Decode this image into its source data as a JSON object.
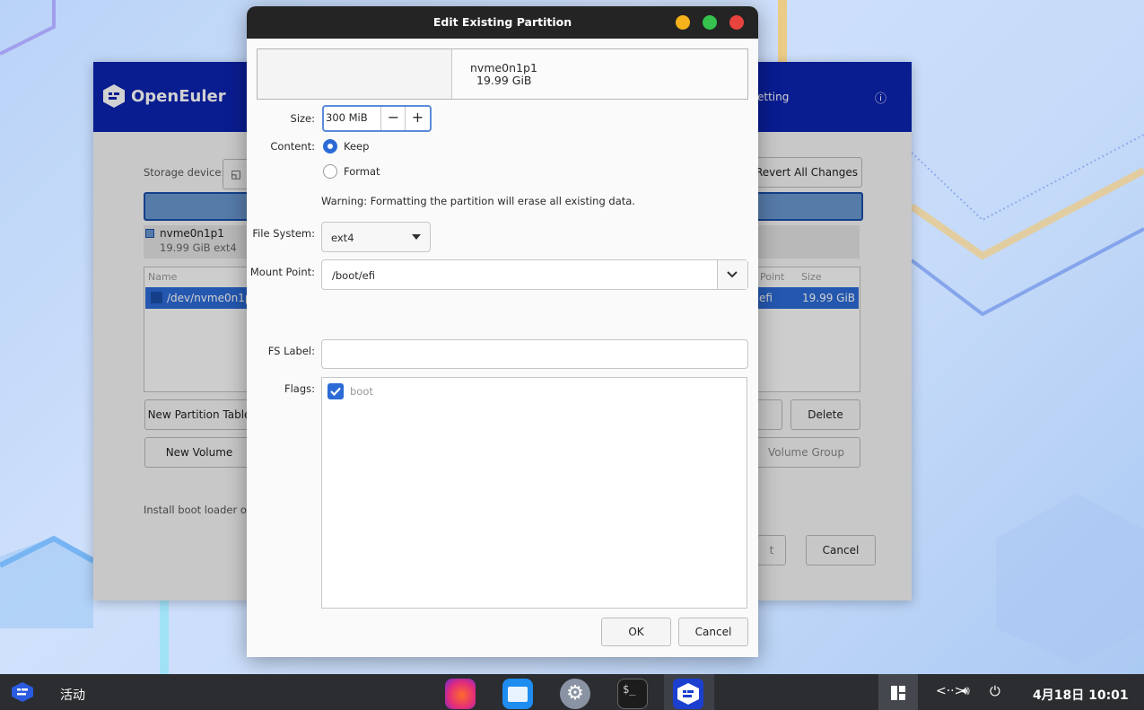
{
  "desktop": {
    "background": "#c6dbf9"
  },
  "installer": {
    "brand": "OpenEuler",
    "header_right": "etting",
    "storage_device_label": "Storage device:",
    "revert_button": "Revert All Changes",
    "device_name": "nvme0n1p1",
    "device_detail": "19.99 GiB  ext4",
    "table": {
      "columns": [
        "Name",
        "Point",
        "Size"
      ],
      "row": {
        "name": "/dev/nvme0n1p",
        "mount": "efi",
        "size": "19.99 GiB"
      }
    },
    "new_partition_table_button": "New Partition Table",
    "delete_button": "Delete",
    "new_volume_button": "New Volume",
    "volume_group_button": "Volume Group",
    "boot_loader_label": "Install boot loader on:",
    "next_button": "t",
    "cancel_button": "Cancel"
  },
  "dialog": {
    "title": "Edit Existing Partition",
    "partition": {
      "name": "nvme0n1p1",
      "size": "19.99 GiB"
    },
    "size_label": "Size:",
    "size_value": "300 MiB",
    "content_label": "Content:",
    "content_options": [
      "Keep",
      "Format"
    ],
    "content_selected": "Keep",
    "warning": "Warning: Formatting the partition will erase all existing data.",
    "filesystem_label": "File System:",
    "filesystem_value": "ext4",
    "mount_label": "Mount Point:",
    "mount_value": "/boot/efi",
    "fslabel_label": "FS Label:",
    "fslabel_value": "",
    "flags_label": "Flags:",
    "flags": [
      {
        "name": "boot",
        "checked": true
      }
    ],
    "ok_button": "OK",
    "cancel_button": "Cancel",
    "accent": "#2c6bd6"
  },
  "taskbar": {
    "activities": "活动",
    "apps": [
      "firefox-icon",
      "files-icon",
      "settings-icon",
      "terminal-icon",
      "openeuler-installer-icon"
    ],
    "clock": "4月18日 10:01"
  }
}
